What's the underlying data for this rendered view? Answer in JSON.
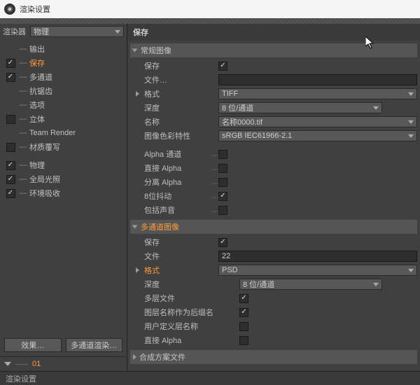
{
  "window": {
    "title": "渲染设置"
  },
  "renderer": {
    "label": "渲染器",
    "value": "物理"
  },
  "categories": [
    {
      "name": "输出",
      "checked": null,
      "active": false
    },
    {
      "name": "保存",
      "checked": true,
      "active": true
    },
    {
      "name": "多通道",
      "checked": true,
      "active": false
    },
    {
      "name": "抗锯齿",
      "checked": null,
      "active": false
    },
    {
      "name": "选项",
      "checked": null,
      "active": false
    },
    {
      "name": "立体",
      "checked": false,
      "active": false
    },
    {
      "name": "Team Render",
      "checked": null,
      "active": false
    },
    {
      "name": "材质覆写",
      "checked": false,
      "active": false
    },
    {
      "name": "物理",
      "checked": true,
      "active": false
    },
    {
      "name": "全局光照",
      "checked": true,
      "active": false
    },
    {
      "name": "环境吸收",
      "checked": true,
      "active": false
    }
  ],
  "left": {
    "effects_btn": "效果…",
    "multipass_btn": "多通道渲染…",
    "preset_name": "01"
  },
  "panel": {
    "title": "保存",
    "group1": "常规图像",
    "group2": "多通道图像",
    "group3": "合成方案文件"
  },
  "g1": {
    "save_label": "保存",
    "save_checked": true,
    "file_label": "文件…",
    "file_value": "",
    "format_label": "格式",
    "format_value": "TIFF",
    "depth_label": "深度",
    "depth_value": "8 位/通道",
    "name_label": "名称",
    "name_value": "名称0000.tif",
    "icc_label": "图像色彩特性",
    "icc_value": "sRGB IEC61966-2.1",
    "alpha_label": "Alpha 通道",
    "alpha_checked": false,
    "straight_label": "直接 Alpha",
    "straight_checked": false,
    "separate_label": "分离 Alpha",
    "separate_checked": false,
    "dither_label": "8位抖动",
    "dither_checked": true,
    "sound_label": "包括声音",
    "sound_checked": false
  },
  "g2": {
    "save_label": "保存",
    "save_checked": true,
    "file_label": "文件",
    "file_value": "22",
    "format_label": "格式",
    "format_value": "PSD",
    "depth_label": "深度",
    "depth_value": "8 位/通道",
    "multilayer_label": "多层文件",
    "multilayer_checked": true,
    "suffix_label": "图层名称作为后缀名",
    "suffix_checked": true,
    "userlayer_label": "用户定义层名称",
    "userlayer_checked": false,
    "straight_label": "直接 Alpha",
    "straight_checked": false
  },
  "statusbar": {
    "text": "渲染设置"
  }
}
